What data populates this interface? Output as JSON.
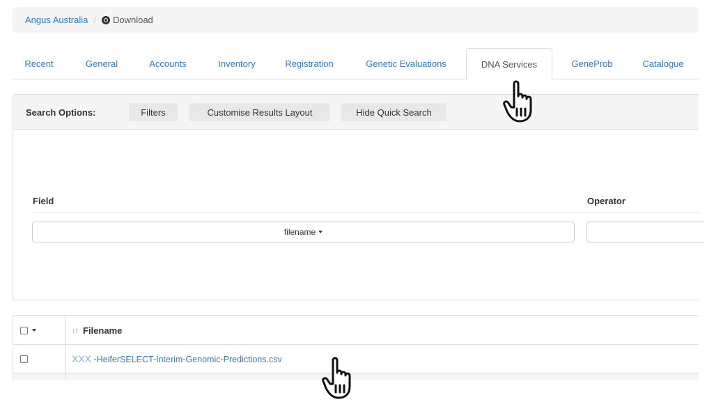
{
  "breadcrumb": {
    "root": "Angus Australia",
    "separator": "/",
    "current": "Download"
  },
  "tabs": [
    {
      "label": "Recent",
      "active": false
    },
    {
      "label": "General",
      "active": false
    },
    {
      "label": "Accounts",
      "active": false
    },
    {
      "label": "Inventory",
      "active": false
    },
    {
      "label": "Registration",
      "active": false
    },
    {
      "label": "Genetic Evaluations",
      "active": false
    },
    {
      "label": "DNA Services",
      "active": true
    },
    {
      "label": "GeneProb",
      "active": false
    },
    {
      "label": "Catalogue",
      "active": false
    }
  ],
  "search": {
    "label": "Search Options:",
    "filters_label": "Filters",
    "customise_label": "Customise Results Layout",
    "hide_quick_label": "Hide Quick Search",
    "field_header": "Field",
    "operator_header": "Operator",
    "field_value": "filename"
  },
  "table": {
    "filename_header": "Filename",
    "rows": [
      {
        "prefix": "XXX",
        "filename": "-HeiferSELECT-Interim-Genomic-Predictions.csv"
      }
    ]
  },
  "icons": {
    "breadcrumb_icon": "download-circle-icon",
    "sort_icon": "sort-icon",
    "cursor": "hand-pointer-icon"
  },
  "colors": {
    "link": "#337ab7",
    "panel_bg": "#f5f5f5",
    "border": "#ddd"
  }
}
